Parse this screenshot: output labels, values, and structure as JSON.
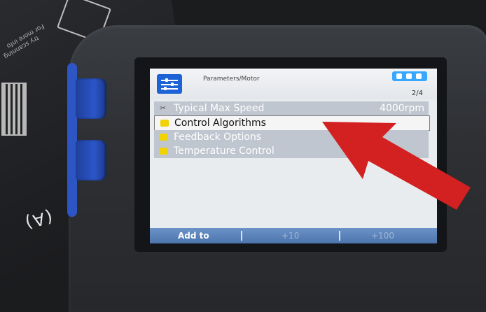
{
  "screen": {
    "breadcrumb": "Parameters/Motor",
    "page": "2/4",
    "rows": [
      {
        "label": "Typical Max Speed",
        "value": "4000rpm",
        "icon": "tool-icon",
        "selected": false
      },
      {
        "label": "Control Algorithms",
        "value": "",
        "icon": "folder-icon",
        "selected": true
      },
      {
        "label": "Feedback Options",
        "value": "",
        "icon": "folder-icon",
        "selected": false
      },
      {
        "label": "Temperature Control",
        "value": "",
        "icon": "folder-icon",
        "selected": false
      }
    ],
    "softkeys": [
      "Add to",
      "+10",
      "+100"
    ]
  },
  "overlay": {
    "arrow_color": "#d32020",
    "arrow_direction": "pointing-left-up"
  },
  "colors": {
    "accent": "#1d63d6",
    "softkey_bar": "#5a84bd",
    "folder": "#f1d300",
    "lcd": "#e9ecef"
  }
}
